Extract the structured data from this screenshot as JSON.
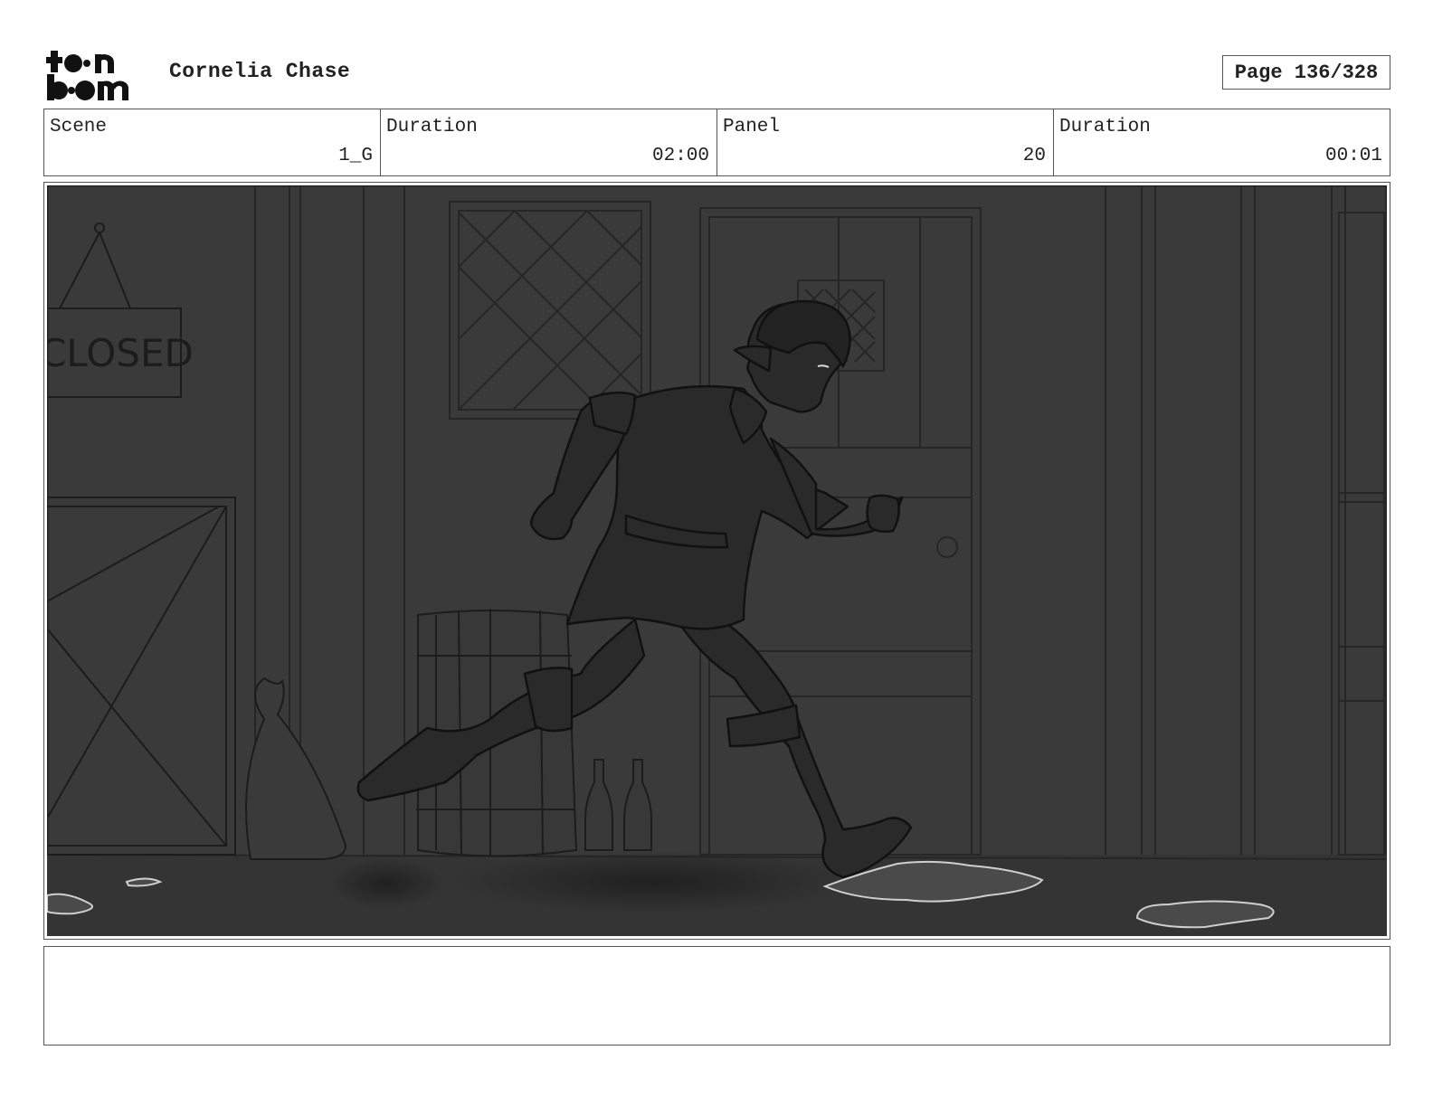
{
  "header": {
    "logo_text": "toonboom",
    "project_title": "Cornelia Chase",
    "page_label": "Page 136/328"
  },
  "info": {
    "scene_label": "Scene",
    "scene_value": "1_G",
    "scene_duration_label": "Duration",
    "scene_duration_value": "02:00",
    "panel_label": "Panel",
    "panel_value": "20",
    "panel_duration_label": "Duration",
    "panel_duration_value": "00:01"
  },
  "panel": {
    "sign_text": "CLOSED"
  },
  "notes": {
    "text": ""
  }
}
